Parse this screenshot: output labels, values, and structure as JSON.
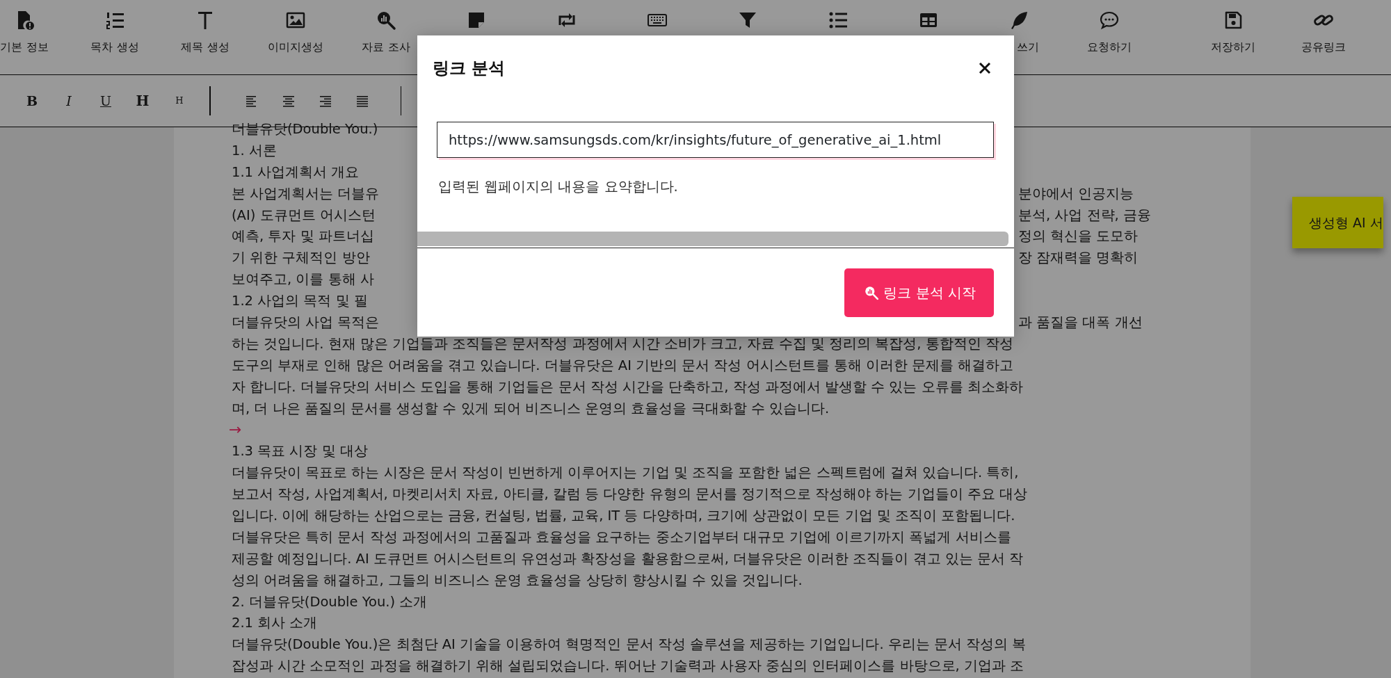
{
  "toolbar": {
    "tools": [
      {
        "kind": "file",
        "label": "기본 정보"
      },
      {
        "kind": "numbers",
        "label": "목차 생성"
      },
      {
        "kind": "title",
        "label": "제목 생성"
      },
      {
        "kind": "image",
        "label": "이미지생성"
      },
      {
        "kind": "research",
        "label": "자료 조사"
      },
      {
        "kind": "note"
      },
      {
        "kind": "swap"
      },
      {
        "kind": "keyboard"
      },
      {
        "kind": "filter"
      },
      {
        "kind": "list"
      },
      {
        "kind": "table"
      },
      {
        "kind": "writing",
        "label": "쓰기",
        "label_cut": true
      },
      {
        "kind": "chat",
        "label": "요청하기"
      }
    ],
    "actions": [
      {
        "kind": "save",
        "label": "저장하기"
      },
      {
        "kind": "share",
        "label": "공유링크"
      }
    ]
  },
  "format_bar": {
    "text_buttons": [
      {
        "kind": "bold",
        "label": "B"
      },
      {
        "kind": "italic",
        "label": "I"
      },
      {
        "kind": "underline",
        "label": "U"
      },
      {
        "kind": "heading",
        "label": "H"
      },
      {
        "kind": "subheading",
        "label": "H"
      }
    ],
    "align_buttons": [
      {
        "kind": "left"
      },
      {
        "kind": "center"
      },
      {
        "kind": "right"
      },
      {
        "kind": "justify"
      }
    ]
  },
  "document": {
    "lines": [
      {
        "left": "더블유닷(Double You.)"
      },
      {
        "text": "1. 서론"
      },
      {
        "text": "1.1 사업계획서 개요"
      },
      {
        "left": "본 사업계획서는 더블유",
        "right": "분야에서 인공지능"
      },
      {
        "left": "(AI) 도큐먼트 어시스턴",
        "right": "분석, 사업 전략, 금융"
      },
      {
        "left": "예측, 투자 및 파트너십",
        "right": "정의 혁신을 도모하"
      },
      {
        "left": "기 위한 구체적인 방안",
        "right": "장 잠재력을 명확히"
      },
      {
        "left": "보여주고, 이를 통해 사"
      },
      {
        "left": "1.2 사업의 목적 및 필"
      },
      {
        "left": "더블유닷의 사업 목적은",
        "right": "과 품질을 대폭 개선"
      },
      {
        "text": "하는 것입니다. 현재 많은 기업들과 조직들은 문서작성 과정에서 시간 소비가 크고, 자료 수집 및 정리의 복잡성, 통합적인 작성"
      },
      {
        "text": "도구의 부재로 인해 많은 어려움을 겪고 있습니다. 더블유닷은 AI 기반의 문서 작성 어시스턴트를 통해 이러한 문제를 해결하고"
      },
      {
        "text": "자 합니다. 더블유닷의 서비스 도입을 통해 기업들은 문서 작성 시간을 단축하고, 작성 과정에서 발생할 수 있는 오류를 최소화하"
      },
      {
        "text": "며, 더 나은 품질의 문서를 생성할 수 있게 되어 비즈니스 운영의 효율성을 극대화할 수 있습니다."
      },
      {
        "marker": "→"
      },
      {
        "text": "1.3 목표 시장 및 대상"
      },
      {
        "text": "더블유닷이 목표로 하는 시장은 문서 작성이 빈번하게 이루어지는 기업 및 조직을 포함한 넓은 스펙트럼에 걸쳐 있습니다. 특히,"
      },
      {
        "text": "보고서 작성, 사업계획서, 마켓리서치 자료, 아티클, 칼럼 등 다양한 유형의 문서를 정기적으로 작성해야 하는 기업들이 주요 대상"
      },
      {
        "text": "입니다. 이에 해당하는 산업으로는 금융, 컨설팅, 법률, 교육, IT 등 다양하며, 크기에 상관없이 모든 기업 및 조직이 포함됩니다."
      },
      {
        "text": "더블유닷은 특히 문서 작성 과정에서의 고품질과 효율성을 요구하는 중소기업부터 대규모 기업에 이르기까지 폭넓게 서비스를"
      },
      {
        "text": "제공할 예정입니다. AI 도큐먼트 어시스턴트의 유연성과 확장성을 활용함으로써, 더블유닷은 이러한 조직들이 겪고 있는 문서 작"
      },
      {
        "text": "성의 어려움을 해결하고, 그들의 비즈니스 운영 효율성을 상당히 향상시킬 수 있을 것입니다."
      },
      {
        "text": "2. 더블유닷(Double You.) 소개"
      },
      {
        "text": "2.1 회사 소개"
      },
      {
        "text": "더블유닷(Double You.)은 최첨단 AI 기술을 이용하여 혁명적인 문서 작성 솔루션을 제공하는 기업입니다. 우리는 문서 작성의 복"
      },
      {
        "text": "잡성과 시간 소모적인 과정을 해결하기 위해 설립되었습니다. 뛰어난 기술력과 사용자 중심의 인터페이스를 바탕으로, 기업과 조"
      }
    ]
  },
  "side_tab": {
    "label": "생성형 AI 서"
  },
  "modal": {
    "title": "링크 분석",
    "url_value": "https://www.samsungsds.com/kr/insights/future_of_generative_ai_1.html",
    "help": "입력된 웹페이지의 내용을 요약합니다.",
    "button": "링크 분석 시작"
  }
}
